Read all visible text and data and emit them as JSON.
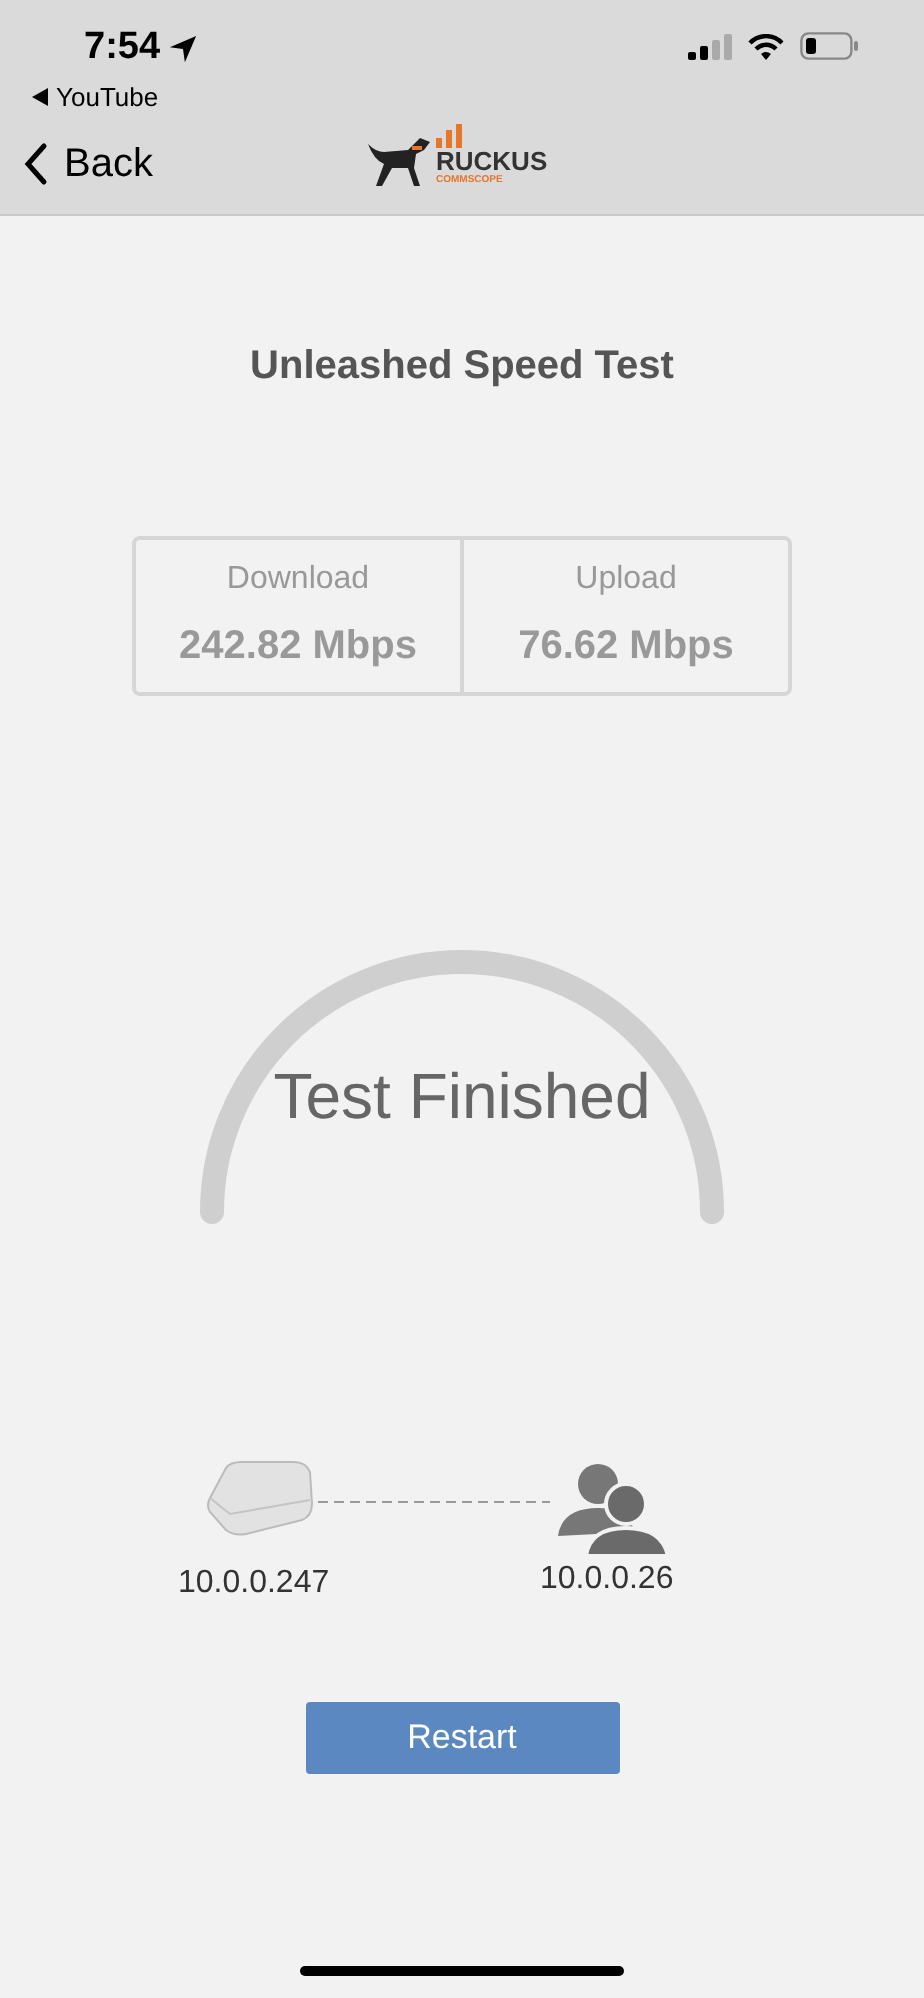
{
  "status_bar": {
    "time": "7:54",
    "back_app": "YouTube"
  },
  "nav": {
    "back_label": "Back",
    "logo": {
      "brand": "RUCKUS",
      "sub": "COMMSCOPE"
    }
  },
  "title": "Unleashed Speed Test",
  "results": [
    {
      "label": "Download",
      "value": "242.82 Mbps"
    },
    {
      "label": "Upload",
      "value": "76.62 Mbps"
    }
  ],
  "gauge": {
    "status": "Test Finished"
  },
  "network": {
    "ap_address": "10.0.0.247",
    "client_address": "10.0.0.26"
  },
  "button": "Restart"
}
